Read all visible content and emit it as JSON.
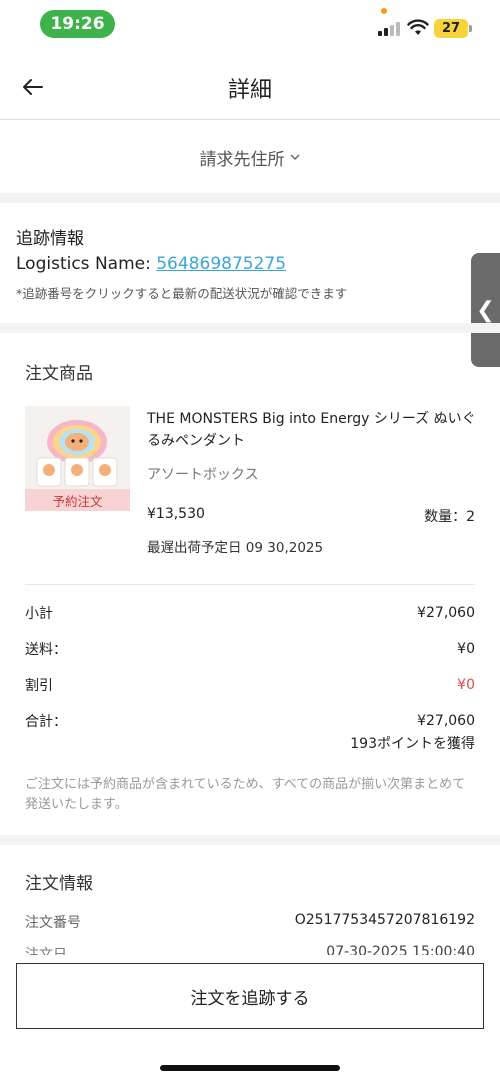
{
  "status_bar": {
    "time": "19:26",
    "battery": "27"
  },
  "header": {
    "title": "詳細"
  },
  "address": {
    "label": "請求先住所"
  },
  "tracking": {
    "title": "追跡情報",
    "logistics_label": "Logistics Name: ",
    "tracking_number": "564869875275",
    "note": "*追跡番号をクリックすると最新の配送状況が確認できます"
  },
  "side_tab": {
    "glyph": "❮"
  },
  "products": {
    "title": "注文商品",
    "items": [
      {
        "name": "THE MONSTERS Big into Energy シリーズ ぬいぐるみペンダント",
        "variant": "アソートボックス",
        "badge": "予約注文",
        "price": "¥13,530",
        "quantity": "数量：2",
        "ship_date": "最遅出荷予定日 09 30,2025"
      }
    ]
  },
  "summary": {
    "subtotal_label": "小計",
    "subtotal_value": "¥27,060",
    "shipping_label": "送料：",
    "shipping_value": "¥0",
    "discount_label": "割引",
    "discount_value": "¥0",
    "total_label": "合計：",
    "total_value": "¥27,060",
    "points": "193ポイントを獲得",
    "notice": "ご注文には予約商品が含まれているため、すべての商品が揃い次第まとめて発送いたします。"
  },
  "order_info": {
    "title": "注文情報",
    "order_number_label": "注文番号",
    "order_number_value": "O251775345720781619​2",
    "order_date_label": "注文日",
    "order_date_value": "07-30-2025 15:00:40"
  },
  "footer": {
    "track_button": "注文を追跡する"
  },
  "colors": {
    "accent_link": "#3aa6d6",
    "badge_bg": "#f9d3d3",
    "discount": "#d94b4b",
    "time_pill": "#3db34a"
  }
}
